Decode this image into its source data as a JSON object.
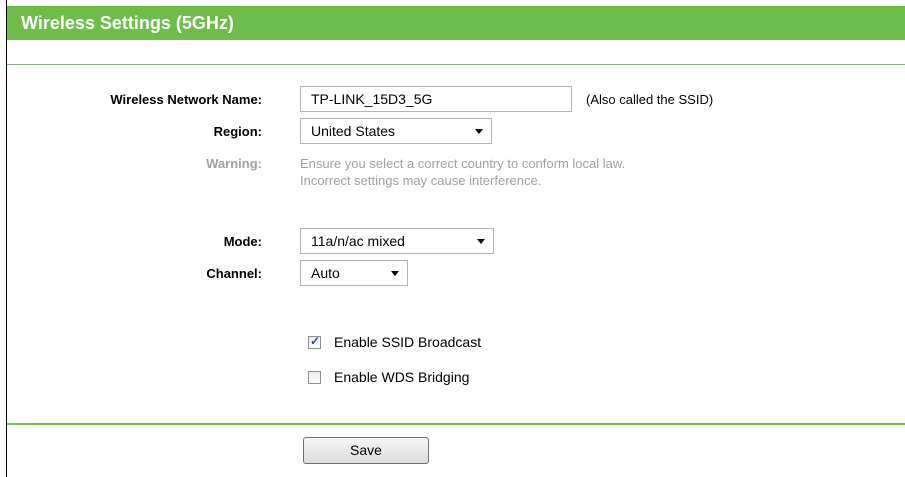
{
  "header": {
    "title": "Wireless Settings (5GHz)"
  },
  "form": {
    "ssid": {
      "label": "Wireless Network Name:",
      "value": "TP-LINK_15D3_5G",
      "hint": "(Also called the SSID)"
    },
    "region": {
      "label": "Region:",
      "value": "United States"
    },
    "warning": {
      "label": "Warning:",
      "line1": "Ensure you select a correct country to conform local law.",
      "line2": "Incorrect settings may cause interference."
    },
    "mode": {
      "label": "Mode:",
      "value": "11a/n/ac mixed"
    },
    "channel": {
      "label": "Channel:",
      "value": "Auto"
    },
    "ssid_broadcast": {
      "label": "Enable SSID Broadcast",
      "checked": true
    },
    "wds_bridging": {
      "label": "Enable WDS Bridging",
      "checked": false
    }
  },
  "actions": {
    "save_label": "Save"
  }
}
